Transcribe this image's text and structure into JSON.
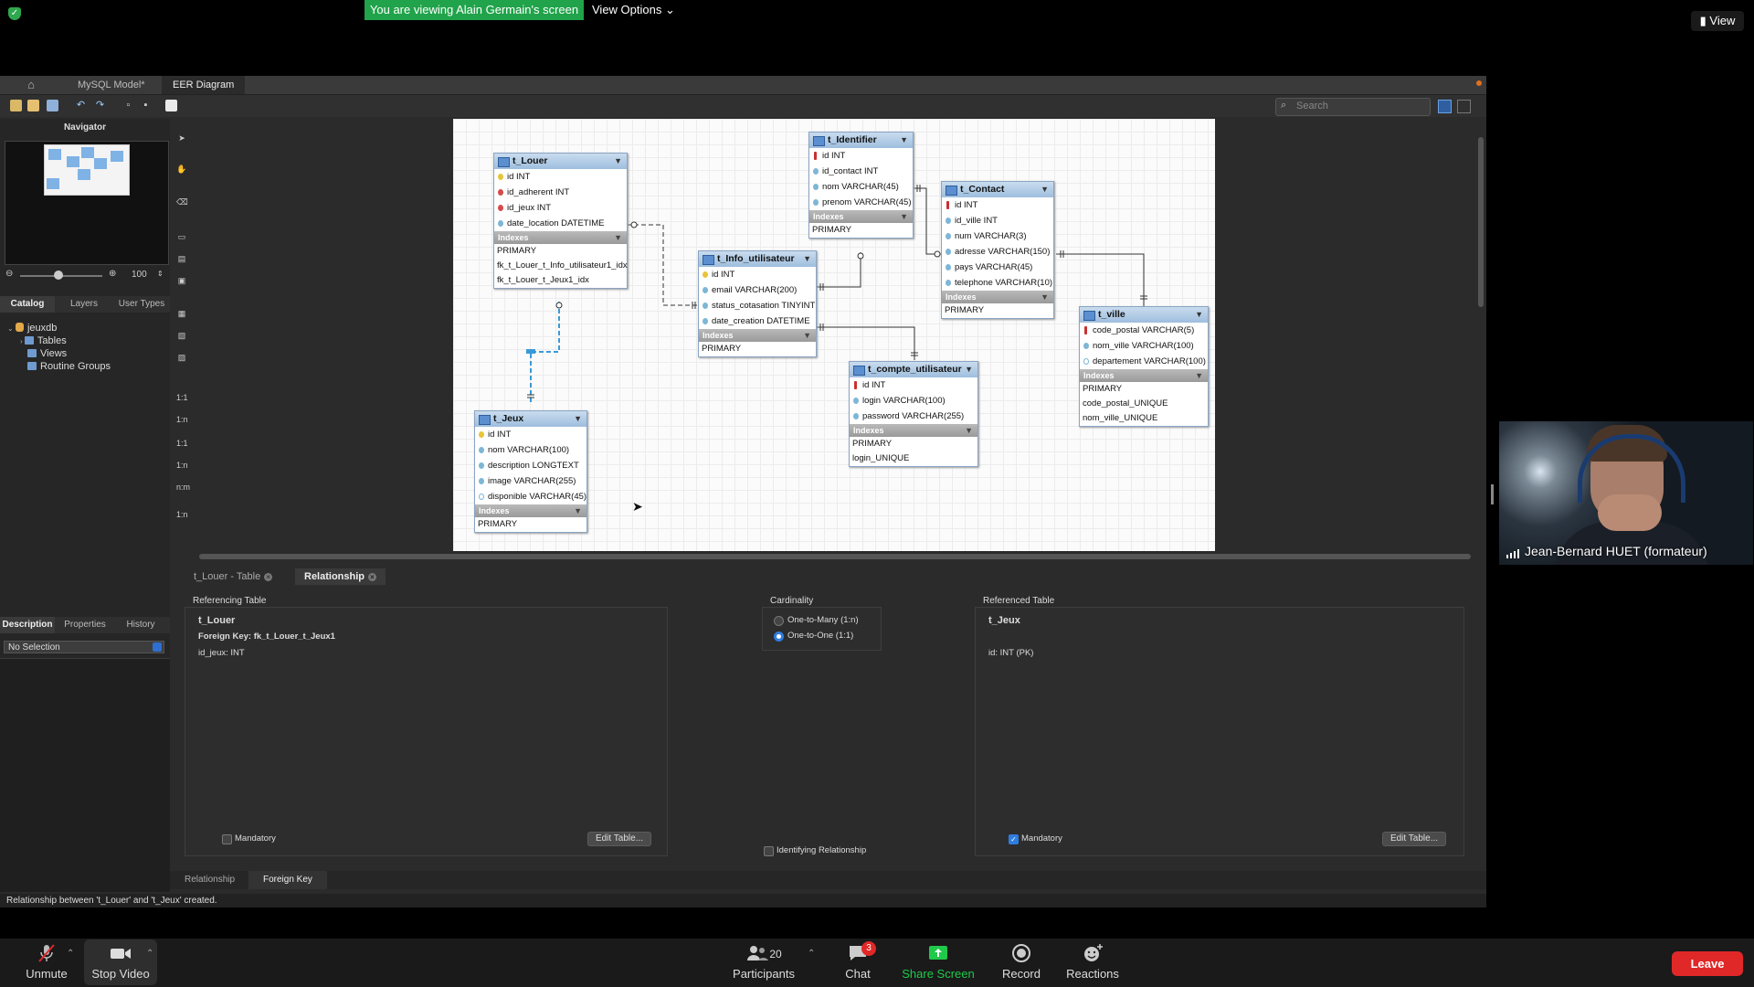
{
  "zoom": {
    "banner": "You are viewing Alain Germain's screen",
    "view_options": "View Options ⌄",
    "view": "View",
    "participant_name": "Jean-Bernard HUET (formateur)",
    "participants_count": "20",
    "chat_badge": "3",
    "buttons": {
      "unmute": "Unmute",
      "stop_video": "Stop Video",
      "participants": "Participants",
      "chat": "Chat",
      "share_screen": "Share Screen",
      "record": "Record",
      "reactions": "Reactions",
      "leave": "Leave"
    },
    "colors": {
      "banner": "#20a34a",
      "leave": "#e02828",
      "share": "#20c94a"
    }
  },
  "workbench": {
    "tabs": {
      "home": "⌂",
      "model": "MySQL Model*",
      "eer": "EER Diagram"
    },
    "search_placeholder": "Search",
    "navigator_title": "Navigator",
    "zoom_level": "100",
    "catalog_tabs": [
      "Catalog",
      "Layers",
      "User Types"
    ],
    "tree": {
      "db": "jeuxdb",
      "items": [
        "Tables",
        "Views",
        "Routine Groups"
      ]
    },
    "desc_tabs": [
      "Description",
      "Properties",
      "History"
    ],
    "no_selection": "No Selection",
    "tools": [
      "1:1",
      "1:n",
      "1:1",
      "1:n",
      "n:m",
      "1:n"
    ],
    "status": "Relationship between 't_Louer' and 't_Jeux' created."
  },
  "tables": {
    "t_louer": {
      "name": "t_Louer",
      "cols": [
        "id INT",
        "id_adherent INT",
        "id_jeux INT",
        "date_location DATETIME"
      ],
      "indexes": [
        "PRIMARY",
        "fk_t_Louer_t_Info_utilisateur1_idx",
        "fk_t_Louer_t_Jeux1_idx"
      ]
    },
    "t_jeux": {
      "name": "t_Jeux",
      "cols": [
        "id INT",
        "nom VARCHAR(100)",
        "description LONGTEXT",
        "image VARCHAR(255)",
        "disponible VARCHAR(45)"
      ],
      "indexes": [
        "PRIMARY"
      ]
    },
    "t_identifier": {
      "name": "t_Identifier",
      "cols": [
        "id INT",
        "id_contact INT",
        "nom VARCHAR(45)",
        "prenom VARCHAR(45)"
      ],
      "indexes": [
        "PRIMARY"
      ]
    },
    "t_info_utilisateur": {
      "name": "t_Info_utilisateur",
      "cols": [
        "id INT",
        "email VARCHAR(200)",
        "status_cotasation TINYINT",
        "date_creation DATETIME"
      ],
      "indexes": [
        "PRIMARY"
      ]
    },
    "t_contact": {
      "name": "t_Contact",
      "cols": [
        "id INT",
        "id_ville INT",
        "num VARCHAR(3)",
        "adresse VARCHAR(150)",
        "pays VARCHAR(45)",
        "telephone VARCHAR(10)"
      ],
      "indexes": [
        "PRIMARY"
      ]
    },
    "t_compte_utilisateur": {
      "name": "t_compte_utilisateur",
      "cols": [
        "id INT",
        "login VARCHAR(100)",
        "password VARCHAR(255)"
      ],
      "indexes": [
        "PRIMARY",
        "login_UNIQUE"
      ]
    },
    "t_ville": {
      "name": "t_ville",
      "cols": [
        "code_postal VARCHAR(5)",
        "nom_ville VARCHAR(100)",
        "departement VARCHAR(100)"
      ],
      "indexes": [
        "PRIMARY",
        "code_postal_UNIQUE",
        "nom_ville_UNIQUE"
      ]
    },
    "indexes_label": "Indexes"
  },
  "editor": {
    "tabs": {
      "table": "t_Louer - Table",
      "relationship": "Relationship"
    },
    "referencing_label": "Referencing Table",
    "referencing_table": "t_Louer",
    "foreign_key": "Foreign Key: fk_t_Louer_t_Jeux1",
    "referencing_col": "id_jeux: INT",
    "cardinality_label": "Cardinality",
    "card_options": [
      "One-to-Many (1:n)",
      "One-to-One (1:1)"
    ],
    "referenced_label": "Referenced Table",
    "referenced_table": "t_Jeux",
    "referenced_col": "id: INT (PK)",
    "mandatory": "Mandatory",
    "edit_table": "Edit Table...",
    "identifying": "Identifying Relationship",
    "subtabs": [
      "Relationship",
      "Foreign Key"
    ]
  }
}
